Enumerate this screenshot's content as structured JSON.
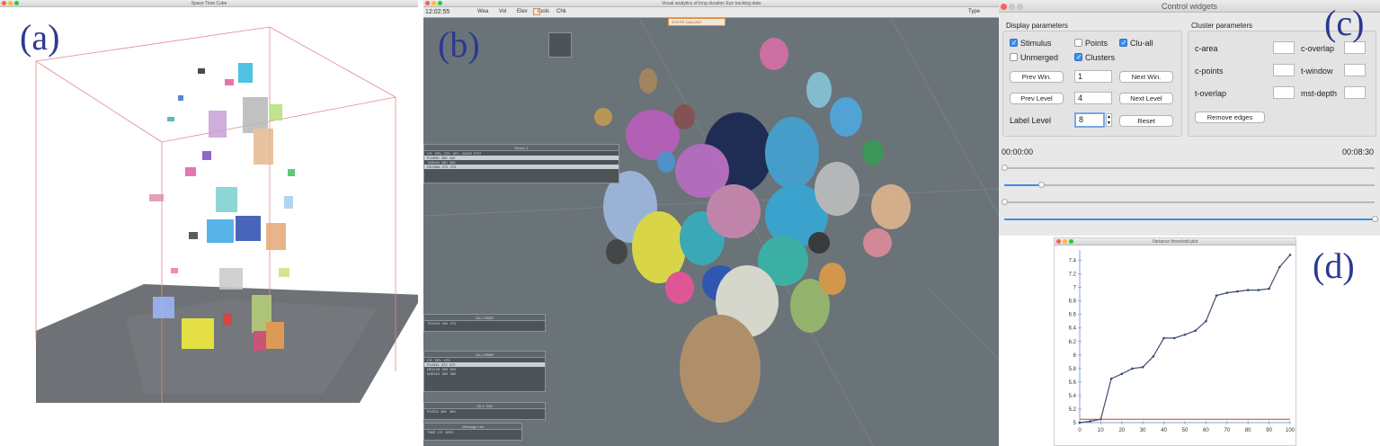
{
  "labels": {
    "a": "(a)",
    "b": "(b)",
    "c": "(c)",
    "d": "(d)"
  },
  "window_a": {
    "title": "Space Time Cube"
  },
  "window_b": {
    "title": "Visual analytics of long duration Eye tracking data",
    "toolbar": {
      "clock": "12:02:55",
      "items": [
        "Wea",
        "Vol",
        "Elev",
        "Tools",
        "Chk"
      ],
      "right": "Type"
    },
    "callout": "SYS FE CALLOUT"
  },
  "window_c": {
    "title": "Control widgets",
    "display_title": "Display parameters",
    "cluster_title": "Cluster parameters",
    "checkboxes": [
      {
        "label": "Stimulus",
        "checked": true
      },
      {
        "label": "Points",
        "checked": false
      },
      {
        "label": "Clu-all",
        "checked": true
      },
      {
        "label": "Unmerged",
        "checked": false
      },
      {
        "label": "Clusters",
        "checked": true
      }
    ],
    "prev_win": "Prev Win.",
    "next_win": "Next Win.",
    "win_value": "1",
    "prev_level": "Prev Level",
    "next_level": "Next Level",
    "level_value": "4",
    "label_level": "Label Level",
    "label_level_value": "8",
    "reset": "Reset",
    "cluster_params": [
      "c-area",
      "c-overlap",
      "c-points",
      "t-window",
      "t-overlap",
      "mst-depth"
    ],
    "remove_edges": "Remove edges",
    "time_start": "00:00:00",
    "time_end": "00:08:30",
    "sliders": [
      0.0,
      0.1,
      0.0,
      1.0
    ]
  },
  "window_d": {
    "title": "Variance threshold plot",
    "chart_data": {
      "type": "line",
      "title": "Variance threshold plot",
      "x": [
        0,
        5,
        10,
        15,
        20,
        25,
        30,
        35,
        40,
        45,
        50,
        55,
        60,
        65,
        70,
        75,
        80,
        85,
        90,
        95,
        100
      ],
      "series": [
        {
          "values": [
            5.0,
            5.02,
            5.05,
            5.65,
            5.72,
            5.8,
            5.82,
            5.98,
            6.25,
            6.25,
            6.3,
            6.36,
            6.5,
            6.88,
            6.92,
            6.94,
            6.96,
            6.96,
            6.98,
            7.3,
            7.48
          ],
          "color": "#3c4b73"
        },
        {
          "values": [
            5.05,
            5.05,
            5.05,
            5.05,
            5.05,
            5.05,
            5.05,
            5.05,
            5.05,
            5.05,
            5.05,
            5.05,
            5.05,
            5.05,
            5.05,
            5.05,
            5.05,
            5.05,
            5.05,
            5.05,
            5.05
          ],
          "color": "#d23b2f"
        }
      ],
      "xticks": [
        0,
        10,
        20,
        30,
        40,
        50,
        60,
        70,
        80,
        90,
        100
      ],
      "yticks": [
        "5",
        "5.2",
        "5.4",
        "5.6",
        "5.8",
        "6",
        "6.2",
        "6.4",
        "6.6",
        "6.8",
        "7",
        "7.2",
        "7.4"
      ],
      "xlim": [
        0,
        100
      ],
      "ylim": [
        5.0,
        7.5
      ]
    }
  }
}
